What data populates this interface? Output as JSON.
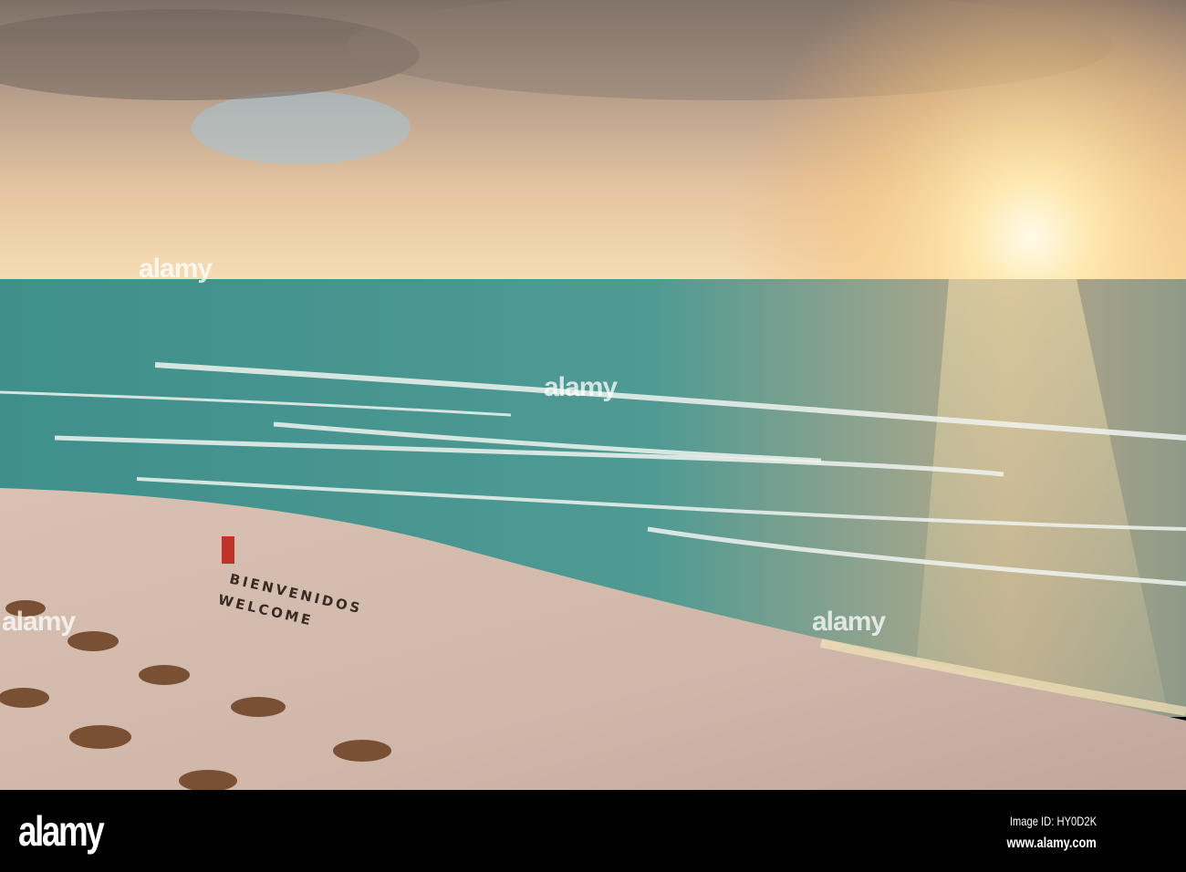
{
  "photo": {
    "subject": "sunrise over beach",
    "sand_text_line1": "BIENVENIDOS",
    "sand_text_line2": "WELCOME"
  },
  "watermark": "alamy",
  "footer": {
    "logo": "alamy",
    "image_id": "Image ID: HY0D2K",
    "website": "www.alamy.com"
  }
}
